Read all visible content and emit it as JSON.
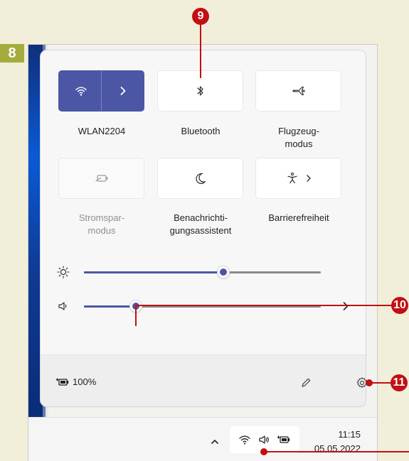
{
  "figure": {
    "step_badge": "8",
    "callouts": [
      "9",
      "10",
      "11"
    ],
    "callout_color": "#c20f14",
    "badge_color": "#a4ac3d"
  },
  "quick_settings": {
    "tiles": [
      {
        "label": "WLAN2204",
        "icon": "wifi-icon",
        "state": "active"
      },
      {
        "label": "Bluetooth",
        "icon": "bluetooth-icon",
        "state": "off"
      },
      {
        "label_lines": [
          "Flugzeug-",
          "modus"
        ],
        "icon": "airplane-icon",
        "state": "off"
      },
      {
        "label_lines": [
          "Stromspar-",
          "modus"
        ],
        "icon": "battery-saver-icon",
        "state": "disabled"
      },
      {
        "label_lines": [
          "Benachrichti-",
          "gungsassistent"
        ],
        "icon": "moon-icon",
        "state": "off"
      },
      {
        "label": "Barrierefreiheit",
        "icon": "accessibility-icon",
        "state": "off"
      }
    ],
    "sliders": {
      "brightness": {
        "icon": "brightness-icon",
        "level": 0.59
      },
      "volume": {
        "icon": "speaker-icon",
        "level": 0.22
      }
    },
    "footer": {
      "battery_percent": "100%",
      "battery_icon": "battery-charging-icon",
      "edit_icon": "pencil-icon",
      "settings_icon": "gear-icon"
    }
  },
  "taskbar": {
    "tray_icons": [
      "chevron-up-icon",
      "wifi-icon",
      "speaker-icon",
      "battery-charging-icon"
    ],
    "time": "11:15",
    "date": "05.05.2022"
  },
  "colors": {
    "accent": "#4b57a4",
    "panel_background": "#f7f7f7",
    "taskbar_background": "#f5f5f5"
  }
}
